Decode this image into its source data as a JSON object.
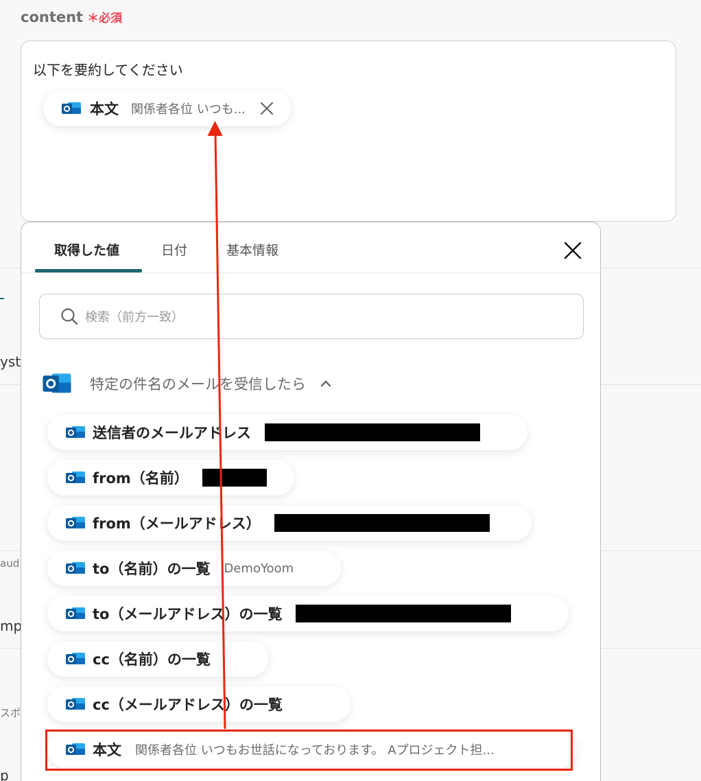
{
  "field": {
    "name": "content",
    "required_mark": "＊",
    "required_label": "必須"
  },
  "content_box": {
    "text": "以下を要約してください",
    "chip": {
      "label": "本文",
      "preview": "関係者各位 いつも..."
    }
  },
  "background_fragments": {
    "line1": "yst",
    "line2": "aud",
    "line3": "mp",
    "line4": "スポ",
    "line5": "p"
  },
  "panel": {
    "tabs": [
      "取得した値",
      "日付",
      "基本情報"
    ],
    "active_tab": "取得した値",
    "search_placeholder": "検索（前方一致）",
    "section_title": "特定の件名のメールを受信したら",
    "items": [
      {
        "label": "送信者のメールアドレス",
        "value": ""
      },
      {
        "label": "from（名前）",
        "value": ""
      },
      {
        "label": "from（メールアドレス）",
        "value": ""
      },
      {
        "label": "to（名前）の一覧",
        "value": "DemoYoom"
      },
      {
        "label": "to（メールアドレス）の一覧",
        "value": ""
      },
      {
        "label": "cc（名前）の一覧",
        "value": ""
      },
      {
        "label": "cc（メールアドレス）の一覧",
        "value": ""
      },
      {
        "label": "本文",
        "value": "関係者各位 いつもお世話になっております。 Aプロジェクト担..."
      }
    ]
  },
  "colors": {
    "accent": "#1d6672",
    "required": "#ec4758",
    "annotation": "#e8260e",
    "outlook_blue": "#0f6cbd"
  },
  "icons": {
    "chip_icon": "outlook-icon",
    "close": "close-icon",
    "search": "search-icon",
    "collapse": "chevron-up-icon"
  }
}
